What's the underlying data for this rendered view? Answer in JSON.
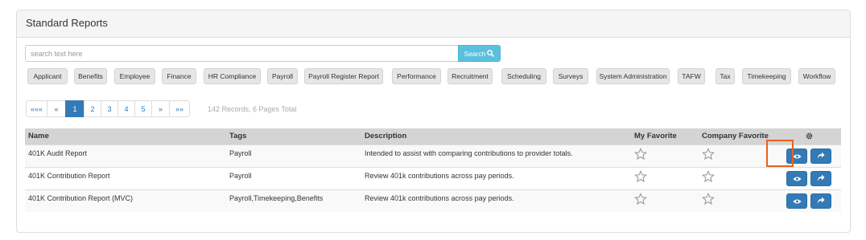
{
  "panel": {
    "title": "Standard Reports"
  },
  "search": {
    "placeholder": "search text here",
    "button_label": "Search"
  },
  "tags": [
    "Applicant",
    "Benefits",
    "Employee",
    "Finance",
    "HR Compliance",
    "Payroll",
    "Payroll Register Report",
    "Performance",
    "Recruitment",
    "Scheduling",
    "Surveys",
    "System Administration",
    "TAFW",
    "Tax",
    "Timekeeping",
    "Workflow"
  ],
  "pagination": {
    "first": "«««",
    "prev": "«",
    "pages": [
      "1",
      "2",
      "3",
      "4",
      "5"
    ],
    "active_page": "1",
    "next": "»",
    "last": "»»",
    "records_text": "142 Records, 6 Pages Total"
  },
  "table": {
    "columns": {
      "name": "Name",
      "tags": "Tags",
      "description": "Description",
      "my_favorite": "My Favorite",
      "company_favorite": "Company Favorite"
    },
    "rows": [
      {
        "name": "401K Audit Report",
        "tags": "Payroll",
        "description": "Intended to assist with comparing contributions to provider totals."
      },
      {
        "name": "401K Contribution Report",
        "tags": "Payroll",
        "description": "Review 401k contributions across pay periods."
      },
      {
        "name": "401K Contribution Report (MVC)",
        "tags": "Payroll,Timekeeping,Benefits",
        "description": "Review 401k contributions across pay periods."
      }
    ]
  },
  "colors": {
    "primary": "#337ab7",
    "info": "#5bc0de",
    "highlight": "#e8621e"
  }
}
